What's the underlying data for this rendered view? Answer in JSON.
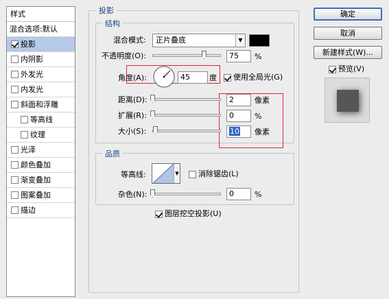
{
  "sidebar": {
    "header": "样式",
    "items": [
      {
        "label": "混合选项:默认",
        "checkbox": false,
        "checked": false,
        "selected": false,
        "indent": false
      },
      {
        "label": "投影",
        "checkbox": true,
        "checked": true,
        "selected": true,
        "indent": false
      },
      {
        "label": "内阴影",
        "checkbox": true,
        "checked": false,
        "selected": false,
        "indent": false
      },
      {
        "label": "外发光",
        "checkbox": true,
        "checked": false,
        "selected": false,
        "indent": false
      },
      {
        "label": "内发光",
        "checkbox": true,
        "checked": false,
        "selected": false,
        "indent": false
      },
      {
        "label": "斜面和浮雕",
        "checkbox": true,
        "checked": false,
        "selected": false,
        "indent": false
      },
      {
        "label": "等高线",
        "checkbox": true,
        "checked": false,
        "selected": false,
        "indent": true
      },
      {
        "label": "纹理",
        "checkbox": true,
        "checked": false,
        "selected": false,
        "indent": true
      },
      {
        "label": "光泽",
        "checkbox": true,
        "checked": false,
        "selected": false,
        "indent": false
      },
      {
        "label": "颜色叠加",
        "checkbox": true,
        "checked": false,
        "selected": false,
        "indent": false
      },
      {
        "label": "渐变叠加",
        "checkbox": true,
        "checked": false,
        "selected": false,
        "indent": false
      },
      {
        "label": "图案叠加",
        "checkbox": true,
        "checked": false,
        "selected": false,
        "indent": false
      },
      {
        "label": "描边",
        "checkbox": true,
        "checked": false,
        "selected": false,
        "indent": false
      }
    ]
  },
  "drop_shadow": {
    "title": "投影",
    "structure": {
      "title": "结构",
      "blend_mode_label": "混合模式:",
      "blend_mode_value": "正片叠底",
      "shadow_color": "#000000",
      "opacity_label": "不透明度(O):",
      "opacity_value": "75",
      "opacity_unit": "%",
      "opacity_level": 0.75,
      "angle_label": "角度(A):",
      "angle_value": "45",
      "angle_unit": "度",
      "global_light_label": "使用全局光(G)",
      "global_light_checked": true,
      "distance_label": "距离(D):",
      "distance_value": "2",
      "distance_unit": "像素",
      "distance_level": 0.0,
      "spread_label": "扩展(R):",
      "spread_value": "0",
      "spread_unit": "%",
      "spread_level": 0.0,
      "size_label": "大小(S):",
      "size_value": "10",
      "size_unit": "像素",
      "size_level": 0.04
    },
    "quality": {
      "title": "品质",
      "contour_label": "等高线:",
      "antialias_label": "消除锯齿(L)",
      "antialias_checked": false,
      "noise_label": "杂色(N):",
      "noise_value": "0",
      "noise_unit": "%",
      "noise_level": 0.0
    },
    "knockout_label": "图层挖空投影(U)",
    "knockout_checked": true
  },
  "buttons": {
    "ok": "确定",
    "cancel": "取消",
    "new_style": "新建样式(W)...",
    "preview_label": "预览(V)",
    "preview_checked": true
  },
  "colors": {
    "accent_blue": "#1c3f8a",
    "highlight_red": "#d8262f",
    "selection": "#b5c9e8",
    "preview_swatch": "#565656"
  }
}
